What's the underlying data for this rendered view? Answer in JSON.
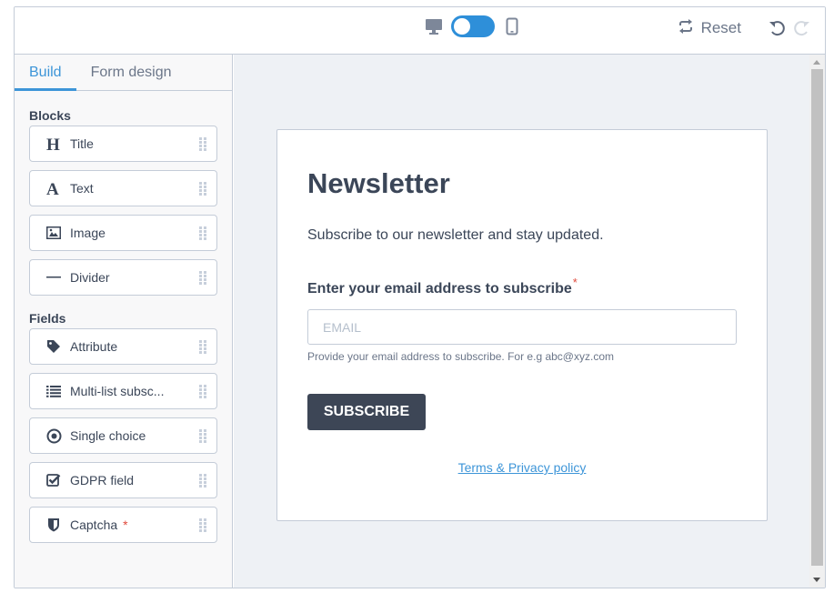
{
  "topbar": {
    "device_toggle": {
      "left_icon": "desktop-icon",
      "right_icon": "mobile-icon",
      "mode": "desktop"
    },
    "reset_label": "Reset",
    "reset_icon": "repeat-icon",
    "undo_icon": "undo-icon",
    "redo_icon": "redo-icon"
  },
  "sidebar": {
    "tabs": [
      {
        "label": "Build",
        "active": true
      },
      {
        "label": "Form design",
        "active": false
      }
    ],
    "blocks_title": "Blocks",
    "blocks": [
      {
        "label": "Title",
        "icon": "heading-icon"
      },
      {
        "label": "Text",
        "icon": "text-icon"
      },
      {
        "label": "Image",
        "icon": "image-icon"
      },
      {
        "label": "Divider",
        "icon": "divider-icon"
      }
    ],
    "fields_title": "Fields",
    "fields": [
      {
        "label": "Attribute",
        "icon": "tag-icon"
      },
      {
        "label": "Multi-list subsc...",
        "icon": "list-icon"
      },
      {
        "label": "Single choice",
        "icon": "radio-icon"
      },
      {
        "label": "GDPR field",
        "icon": "checkbox-icon"
      },
      {
        "label": "Captcha",
        "icon": "shield-icon",
        "required_mark": "*"
      }
    ]
  },
  "form": {
    "title": "Newsletter",
    "subtitle": "Subscribe to our newsletter and stay updated.",
    "email_label": "Enter your email address to subscribe",
    "required_mark": "*",
    "email_placeholder": "EMAIL",
    "email_value": "",
    "help_text": "Provide your email address to subscribe. For e.g abc@xyz.com",
    "submit_label": "SUBSCRIBE",
    "terms_link": "Terms & Privacy policy"
  },
  "colors": {
    "accent": "#3d95d8",
    "toggle": "#2e8fd9",
    "button": "#3d4656",
    "required": "#e04b3d",
    "canvas_bg": "#eef1f5"
  }
}
